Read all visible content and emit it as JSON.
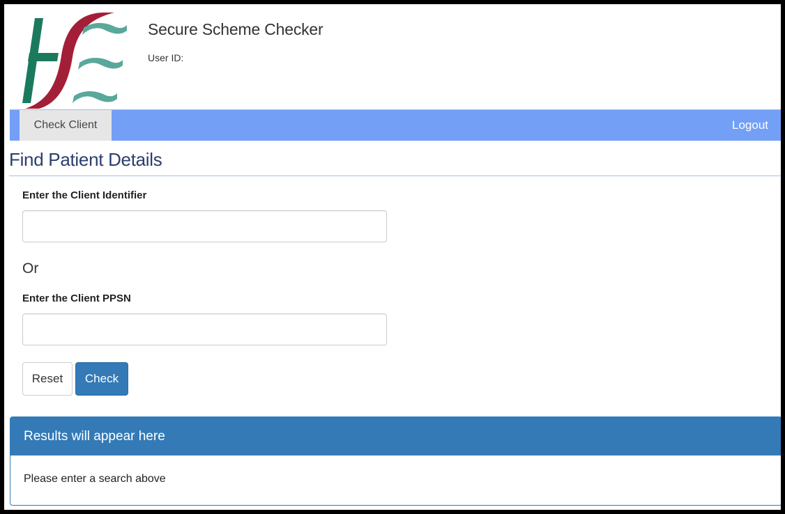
{
  "header": {
    "logo_text": "HSE",
    "app_title": "Secure Scheme Checker",
    "user_id_label": "User ID:"
  },
  "nav": {
    "tabs": [
      {
        "label": "Check Client",
        "active": true
      }
    ],
    "logout_label": "Logout"
  },
  "main": {
    "title": "Find Patient Details",
    "client_identifier": {
      "label": "Enter the Client Identifier",
      "value": "",
      "placeholder": ""
    },
    "or_text": "Or",
    "client_ppsn": {
      "label": "Enter the Client PPSN",
      "value": "",
      "placeholder": ""
    },
    "buttons": {
      "reset_label": "Reset",
      "check_label": "Check"
    }
  },
  "results": {
    "heading": "Results will appear here",
    "body": "Please enter a search above"
  },
  "colors": {
    "nav_bar": "#739ff7",
    "primary": "#337ab7",
    "logo_green": "#1b7a5e",
    "logo_red": "#a31f37",
    "logo_teal": "#5aa89a"
  }
}
